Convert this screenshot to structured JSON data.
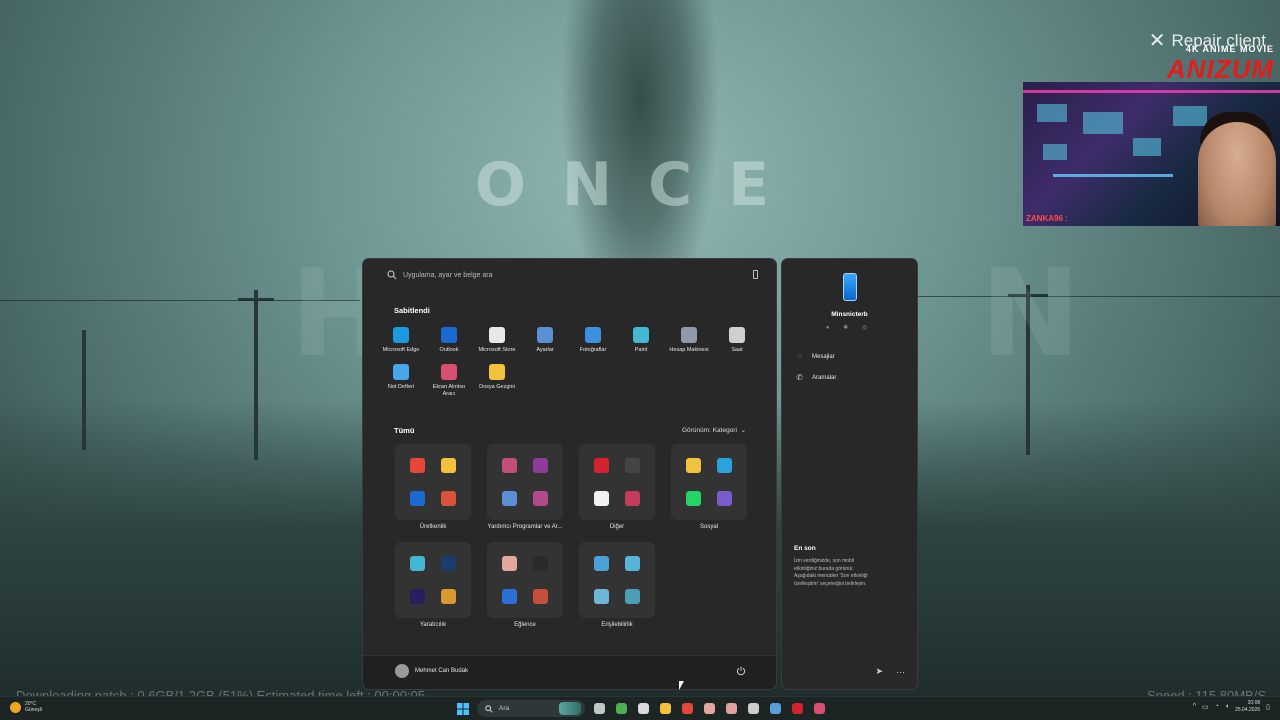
{
  "wallpaper": {
    "title": "ONCE",
    "subtitle": "HUMAN"
  },
  "overlay": {
    "repair_label": "Repair client",
    "brand_small": "4K ANIME MOVIE",
    "brand_big": "ANIZUM",
    "cam_caption": "ZANKA96 :",
    "download_text": "Downloading patch : 0.6GB/1.2GB (51%)     Estimated time left : 00:00:05",
    "speed_text": "Speed : 115.80MB/S"
  },
  "start_menu": {
    "search_placeholder": "Uygulama, ayar ve belge ara",
    "pinned_title": "Sabitlendi",
    "pinned": [
      {
        "label": "Microsoft Edge",
        "icon": "edge-icon",
        "color": "#1a9be0"
      },
      {
        "label": "Outlook",
        "icon": "outlook-icon",
        "color": "#1b6ad1"
      },
      {
        "label": "Microsoft Store",
        "icon": "store-icon",
        "color": "#e8e8e8"
      },
      {
        "label": "Ayarlar",
        "icon": "settings-icon",
        "color": "#5a8fd6"
      },
      {
        "label": "Fotoğraflar",
        "icon": "photos-icon",
        "color": "#3d8fe0"
      },
      {
        "label": "Paint",
        "icon": "paint-icon",
        "color": "#44b7d3"
      },
      {
        "label": "Hesap Makinesi",
        "icon": "calculator-icon",
        "color": "#8e9aa8"
      },
      {
        "label": "Saat",
        "icon": "clock-icon",
        "color": "#cfcfcf"
      },
      {
        "label": "Not Defteri",
        "icon": "notepad-icon",
        "color": "#49a6e9"
      },
      {
        "label": "Ekran Alıntısı Aracı",
        "icon": "snipping-tool-icon",
        "color": "#d94f72"
      },
      {
        "label": "Dosya Gezgini",
        "icon": "file-explorer-icon",
        "color": "#f3c23d"
      }
    ],
    "all_title": "Tümü",
    "view_label": "Görünüm: Kategori",
    "categories": [
      {
        "label": "Üretkenlik",
        "icons": [
          {
            "name": "chrome-icon",
            "color": "#e5463a"
          },
          {
            "name": "file-explorer-icon",
            "color": "#f3c23d"
          },
          {
            "name": "outlook-icon",
            "color": "#1b6ad1"
          },
          {
            "name": "office-icon",
            "color": "#d9533b"
          }
        ]
      },
      {
        "label": "Yardımcı Programlar ve Ar...",
        "icons": [
          {
            "name": "snipping-tool-icon",
            "color": "#c24f7a"
          },
          {
            "name": "winrar-icon",
            "color": "#8e3c9b"
          },
          {
            "name": "settings-icon",
            "color": "#5a8fd6"
          },
          {
            "name": "tools-icon",
            "color": "#b04a8c"
          }
        ]
      },
      {
        "label": "Diğer",
        "icons": [
          {
            "name": "opera-icon",
            "color": "#d3232f"
          },
          {
            "name": "obs-icon",
            "color": "#444444"
          },
          {
            "name": "document-icon",
            "color": "#f2f2f2"
          },
          {
            "name": "apps-icon",
            "color": "#c43c5a"
          }
        ]
      },
      {
        "label": "Sosyal",
        "icons": [
          {
            "name": "discord-icon",
            "color": "#f0c23d"
          },
          {
            "name": "telegram-icon",
            "color": "#2aa3dd"
          },
          {
            "name": "whatsapp-icon",
            "color": "#25d366"
          },
          {
            "name": "social-apps-icon",
            "color": "#7a5ccc"
          }
        ]
      },
      {
        "label": "Yaratıcılık",
        "icons": [
          {
            "name": "paint-icon",
            "color": "#44b7d3"
          },
          {
            "name": "photoshop-icon",
            "color": "#1c3c6e"
          },
          {
            "name": "premiere-icon",
            "color": "#2a1e5e"
          },
          {
            "name": "creative-apps-icon",
            "color": "#d69a2f"
          }
        ]
      },
      {
        "label": "Eğlence",
        "icons": [
          {
            "name": "game-icon",
            "color": "#e2a8a0"
          },
          {
            "name": "epic-games-icon",
            "color": "#2b2b2b"
          },
          {
            "name": "game-launcher-icon",
            "color": "#2c6fd6"
          },
          {
            "name": "media-icon",
            "color": "#c44f3a"
          }
        ]
      },
      {
        "label": "Erişilebilirlik",
        "icons": [
          {
            "name": "magnifier-icon",
            "color": "#4ca0d8"
          },
          {
            "name": "onscreen-keyboard-icon",
            "color": "#56b4d8"
          },
          {
            "name": "narrator-icon",
            "color": "#6db6d8"
          },
          {
            "name": "accessibility-icon",
            "color": "#4a9fb3"
          }
        ]
      }
    ],
    "user_name": "Mehmet Can Budak"
  },
  "phone_panel": {
    "device_name": "Minsnicterb",
    "status_icons": "● ✱ ◎",
    "messages_label": "Mesajlar",
    "calls_label": "Aramalar",
    "recent_title": "En son",
    "recent_text": "İzin verdiğinizde, son mobil etkinliğiniz burada görünür. Aşağıdaki menüden 'Son etkinliği özelleştirin' seçeneğini belirleyin."
  },
  "taskbar": {
    "weather_temp": "20°C",
    "weather_desc": "Güneşli",
    "search_label": "Ara",
    "tray_chevron": "^",
    "time": "20:08",
    "date": "25.04.2026"
  }
}
